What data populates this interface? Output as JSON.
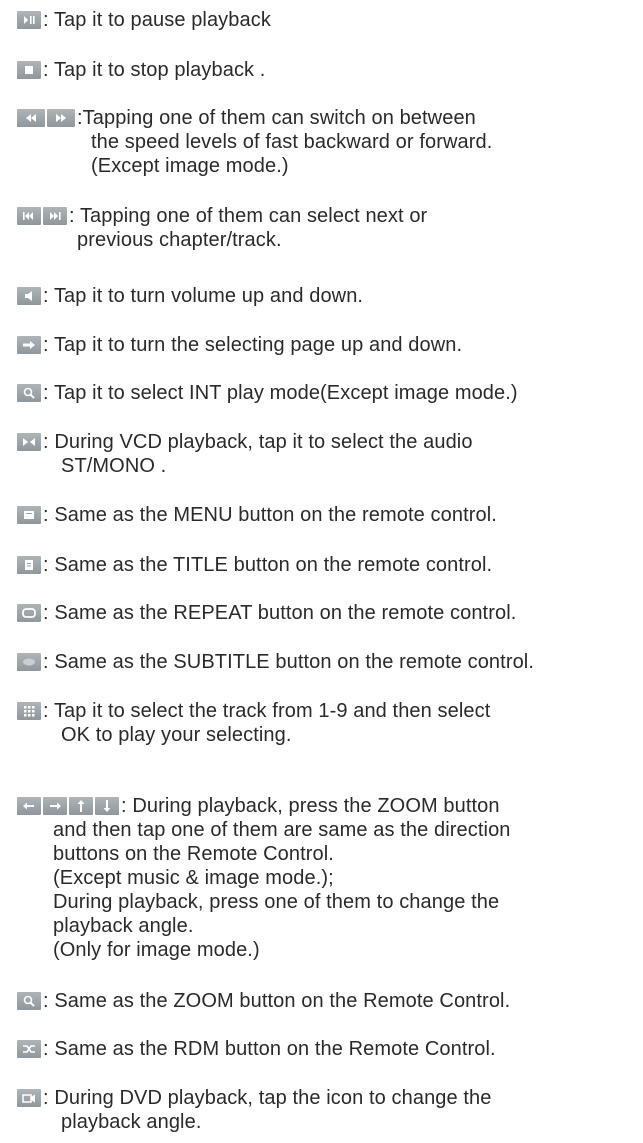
{
  "entries": [
    {
      "icons": [
        "pause-icon"
      ],
      "lines": [
        " : Tap it to pause playback"
      ]
    },
    {
      "icons": [
        "stop-icon"
      ],
      "lines": [
        " : Tap it to stop playback ."
      ]
    },
    {
      "icons": [
        "rewind-icon",
        "fast-forward-icon"
      ],
      "lines": [
        ":Tapping one of them can switch on between",
        "the speed levels of fast backward or forward.",
        "(Except image mode.)"
      ]
    },
    {
      "icons": [
        "previous-track-icon",
        "next-track-icon"
      ],
      "lines": [
        ": Tapping one of them can select next or",
        " previous chapter/track."
      ]
    },
    {
      "icons": [
        "volume-icon"
      ],
      "lines": [
        " : Tap it to turn volume up and down."
      ]
    },
    {
      "icons": [
        "page-arrow-icon"
      ],
      "lines": [
        " : Tap it to turn the selecting page up and down."
      ]
    },
    {
      "icons": [
        "int-play-icon"
      ],
      "lines": [
        " : Tap it to select INT play mode(Except image mode.)"
      ]
    },
    {
      "icons": [
        "audio-icon"
      ],
      "lines": [
        " : During VCD playback, tap it to select the audio",
        "ST/MONO ."
      ]
    },
    {
      "icons": [
        "menu-icon"
      ],
      "lines": [
        " : Same as the MENU button on the remote control."
      ]
    },
    {
      "icons": [
        "title-icon"
      ],
      "lines": [
        " : Same as the TITLE button on the remote control."
      ]
    },
    {
      "icons": [
        "repeat-icon"
      ],
      "lines": [
        " : Same as the REPEAT button on the remote control."
      ]
    },
    {
      "icons": [
        "subtitle-icon"
      ],
      "lines": [
        " : Same as the SUBTITLE button on the remote control."
      ]
    },
    {
      "icons": [
        "number-pad-icon"
      ],
      "lines": [
        " : Tap it to select the track from 1-9 and then select",
        "OK to play your selecting."
      ]
    },
    {
      "icons": [
        "arrow-left-icon",
        "arrow-right-icon",
        "arrow-up-icon",
        "arrow-down-icon"
      ],
      "lines": [
        " : During playback, press the ZOOM button",
        "and then tap one of them are same as the direction",
        "buttons on the Remote Control.",
        "(Except music & image mode.);",
        "During playback, press one of them to change the",
        "playback angle.",
        "(Only for image mode.)"
      ]
    },
    {
      "icons": [
        "zoom-icon"
      ],
      "lines": [
        " : Same as the ZOOM button on the Remote Control."
      ]
    },
    {
      "icons": [
        "random-icon"
      ],
      "lines": [
        " : Same as the RDM button on the Remote Control."
      ]
    },
    {
      "icons": [
        "angle-icon"
      ],
      "lines": [
        " : During DVD playback, tap the icon to change the",
        "playback angle."
      ]
    }
  ]
}
